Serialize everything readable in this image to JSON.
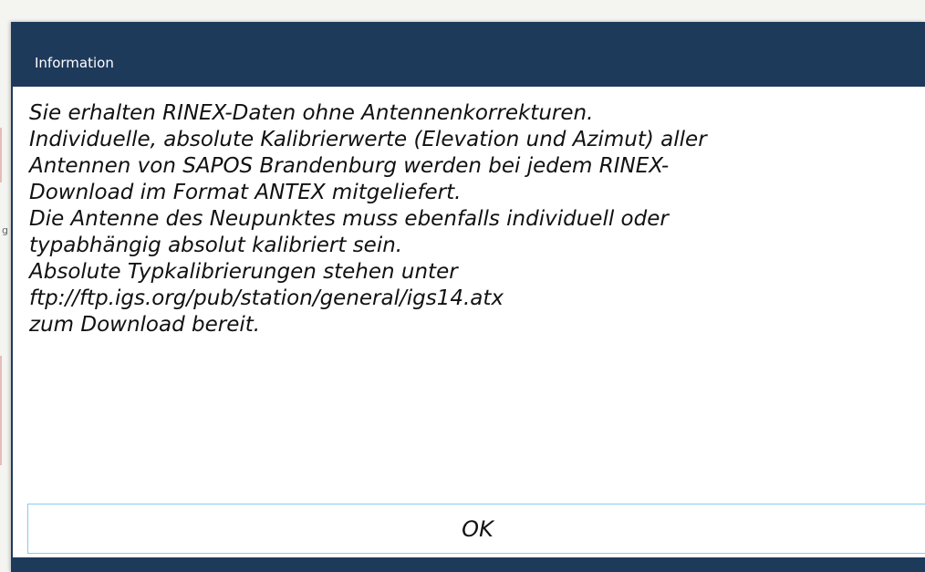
{
  "dialog": {
    "title": "Information",
    "message_lines": [
      "Sie erhalten RINEX-Daten ohne Antennenkorrekturen.",
      "Individuelle, absolute Kalibrierwerte (Elevation und Azimut) aller",
      "Antennen von SAPOS Brandenburg werden bei jedem RINEX-",
      "Download im Format ANTEX mitgeliefert.",
      "Die Antenne des Neupunktes muss ebenfalls individuell oder",
      "typabhängig absolut kalibriert sein.",
      "Absolute Typkalibrierungen stehen unter",
      "ftp://ftp.igs.org/pub/station/general/igs14.atx",
      "zum Download bereit."
    ],
    "ok_label": "OK"
  },
  "background": {
    "fragment_text": "g"
  },
  "colors": {
    "titlebar": "#1e3a5b",
    "button_border": "#7fd0ef",
    "backdrop": "#f4f4f0"
  }
}
